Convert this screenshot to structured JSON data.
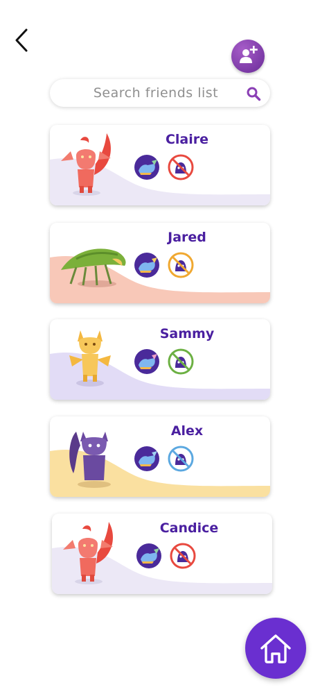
{
  "search": {
    "placeholder": "Search friends list"
  },
  "friends": [
    {
      "name": "Claire",
      "pet": "red-dragon-pet",
      "accent": "#ece8f6",
      "status": "#e8493f"
    },
    {
      "name": "Jared",
      "pet": "green-spider-pet",
      "accent": "#f8c8b8",
      "status": "#f0a830"
    },
    {
      "name": "Sammy",
      "pet": "yellow-fox-pet",
      "accent": "#e2dcf6",
      "status": "#6cb043"
    },
    {
      "name": "Alex",
      "pet": "purple-wolf-pet",
      "accent": "#fae0a0",
      "status": "#5ba8e0"
    },
    {
      "name": "Candice",
      "pet": "red-dragon-pet",
      "accent": "#ece8f6",
      "status": "#e8493f"
    }
  ],
  "colors": {
    "brand": "#6a2fd0",
    "name": "#4a1fa0"
  }
}
